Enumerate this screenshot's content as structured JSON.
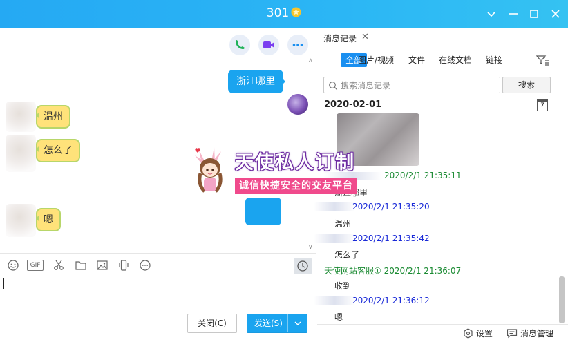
{
  "window": {
    "title": "301",
    "controls": [
      "chevron-down",
      "minimize",
      "maximize",
      "close"
    ]
  },
  "chat": {
    "actions": [
      "phone",
      "video",
      "more"
    ],
    "messages": [
      {
        "side": "out",
        "text": "浙江哪里"
      },
      {
        "side": "in",
        "text": "温州"
      },
      {
        "side": "in",
        "text": "怎么了"
      },
      {
        "side": "in",
        "text": "嗯"
      }
    ],
    "toolbar": [
      "emoji",
      "gif",
      "scissors",
      "folder",
      "image",
      "shake",
      "more",
      "history"
    ],
    "gif_label": "GIF",
    "close_label": "关闭(C)",
    "send_label": "发送(S)"
  },
  "history": {
    "tab_label": "消息记录",
    "filters": [
      "全部",
      "图片/视频",
      "文件",
      "在线文档",
      "链接"
    ],
    "search_placeholder": "搜索消息记录",
    "search_button": "搜索",
    "date": "2020-02-01",
    "calendar_day": "7",
    "entries": [
      {
        "time": "2020/2/1 21:35:11",
        "text": "浙江哪里",
        "color": "green"
      },
      {
        "time": "2020/2/1 21:35:20",
        "text": "温州",
        "color": "blue"
      },
      {
        "time": "2020/2/1 21:35:42",
        "text": "怎么了",
        "color": "blue"
      },
      {
        "sender": "天使网站客服①",
        "time": "2020/2/1 21:36:07",
        "text": "收到",
        "color": "green"
      },
      {
        "time": "2020/2/1 21:36:12",
        "text": "嗯",
        "color": "blue"
      }
    ],
    "settings_label": "设置",
    "manage_label": "消息管理"
  },
  "banner": {
    "title": "天使私人订制",
    "subtitle": "诚信快捷安全的交友平台"
  },
  "colors": {
    "accent": "#1aa4ef",
    "title_bar": "#2bb6f5",
    "green_time": "#1a8a32",
    "blue_time": "#1a2ad8"
  }
}
